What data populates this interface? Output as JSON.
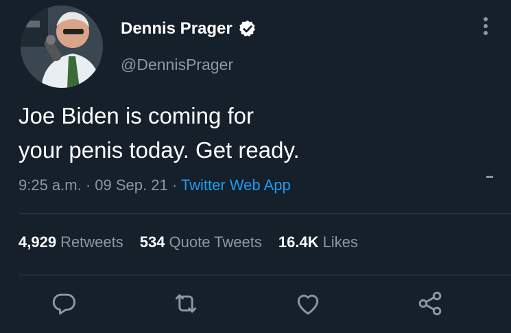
{
  "author": {
    "display_name": "Dennis Prager",
    "handle": "@DennisPrager",
    "verified": true,
    "verified_icon": "verified-badge-icon"
  },
  "tweet": {
    "text_line1": "Joe Biden is coming for",
    "text_line2": "your penis today. Get ready."
  },
  "meta": {
    "time": "9:25 a.m.",
    "sep1": "·",
    "date": "09 Sep. 21",
    "sep2": "·",
    "source": "Twitter Web App"
  },
  "stats": {
    "retweets_count": "4,929",
    "retweets_label": "Retweets",
    "quotes_count": "534",
    "quotes_label": "Quote Tweets",
    "likes_count": "16.4K",
    "likes_label": "Likes"
  },
  "actions": [
    "reply-icon",
    "retweet-icon",
    "like-icon",
    "share-icon"
  ],
  "colors": {
    "background": "#15202b",
    "text": "#ffffff",
    "secondary": "#8b98a5",
    "link": "#1d9bf0",
    "divider": "#38444d"
  }
}
